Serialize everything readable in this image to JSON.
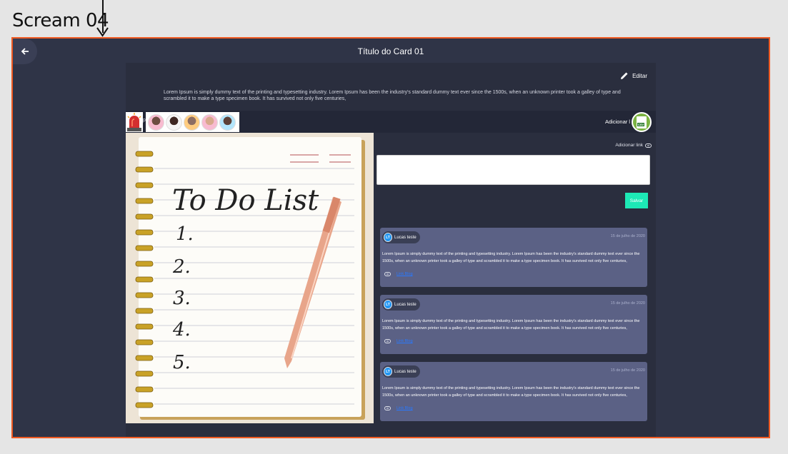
{
  "frame": {
    "label": "Scream 04"
  },
  "header": {
    "title": "Título do Card 01"
  },
  "card": {
    "edit_label": "Editar",
    "description": "Lorem Ipsum is simply dummy text of the printing and typesetting industry. Lorem Ipsum has been the industry's standard dummy text ever since the 1500s, when an unknown printer took a galley of type and scrambled it to make a type specimen book. It has survived not only five centuries,",
    "strip_fragment": "p",
    "add_label": "Adicionar l",
    "csv_label": "CSV",
    "image_text": {
      "title": "To Do List",
      "items": [
        "1.",
        "2.",
        "3.",
        "4.",
        "5."
      ]
    }
  },
  "links": {
    "add_link_label": "Adicionar link",
    "input_value": "",
    "save_label": "Salvar"
  },
  "comments": [
    {
      "author": "Lucas teste",
      "initials": "LT",
      "date": "15 de julho de 2020",
      "text": "Lorem Ipsum is simply dummy text of the printing and typesetting industry. Lorem Ipsum has been the industry's standard dummy text ever since the 1500s, when an unknown printer took a galley of type and scrambled it to make a type specimen book. It has survived not only five centuries,",
      "link_text": "Link Blog"
    },
    {
      "author": "Lucas teste",
      "initials": "LT",
      "date": "15 de julho de 2020",
      "text": "Lorem Ipsum is simply dummy text of the printing and typesetting industry. Lorem Ipsum has been the industry's standard dummy text ever since the 1500s, when an unknown printer took a galley of type and scrambled it to make a type specimen book. It has survived not only five centuries,",
      "link_text": "Link Blog"
    },
    {
      "author": "Lucas teste",
      "initials": "LT",
      "date": "15 de julho de 2020",
      "text": "Lorem Ipsum is simply dummy text of the printing and typesetting industry. Lorem Ipsum has been the industry's standard dummy text ever since the 1500s, when an unknown printer took a galley of type and scrambled it to make a type specimen book. It has survived not only five centuries,",
      "link_text": "Link Blog"
    }
  ],
  "colors": {
    "accent_border": "#f05a22",
    "save_button": "#1de9b6",
    "comment_card": "#5b6185",
    "link": "#2979ff"
  }
}
